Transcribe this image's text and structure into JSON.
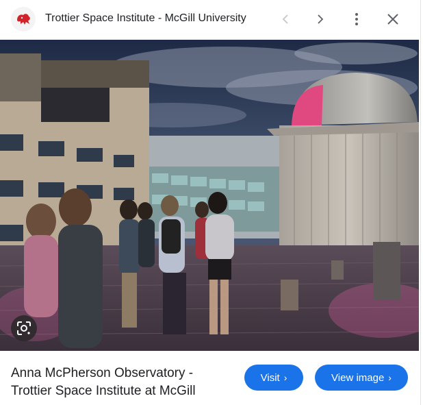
{
  "header": {
    "title": "Trottier Space Institute - McGill University",
    "favicon_icon": "mcgill-crest-icon",
    "back_icon": "chevron-left-icon",
    "forward_icon": "chevron-right-icon",
    "menu_icon": "more-vert-icon",
    "close_icon": "close-icon"
  },
  "image": {
    "lens_icon": "google-lens-icon"
  },
  "caption": {
    "line1": "Anna McPherson Observatory -",
    "line2": "Trottier Space Institute at McGill"
  },
  "actions": {
    "visit_label": "Visit",
    "view_image_label": "View image",
    "chevron": "›"
  },
  "colors": {
    "accent": "#1a73e8",
    "favicon_red": "#d0232a"
  }
}
